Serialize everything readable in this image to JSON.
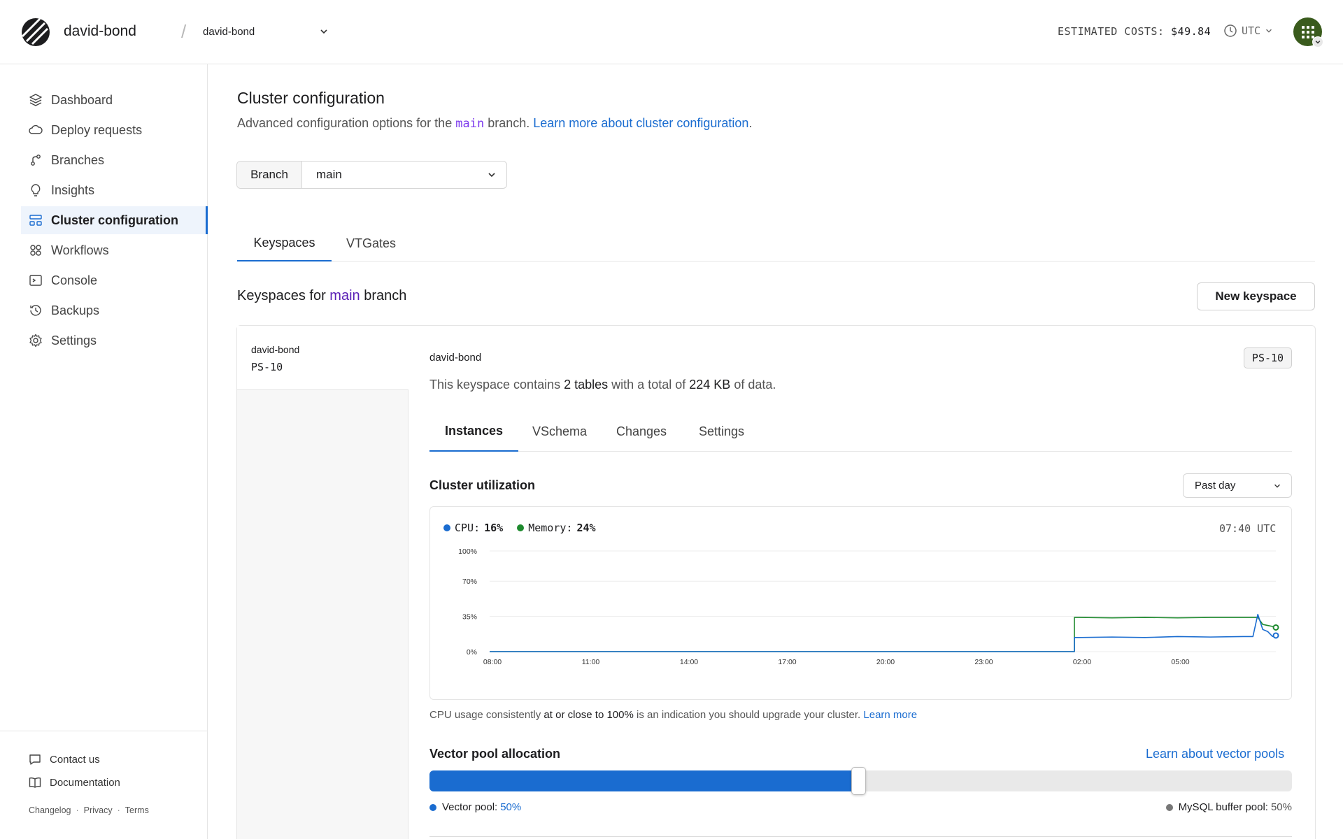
{
  "header": {
    "org_name": "david-bond",
    "database_select": "david-bond",
    "estimated_costs_label": "ESTIMATED COSTS:",
    "estimated_costs_value": "$49.84",
    "timezone": "UTC"
  },
  "sidebar": {
    "items": [
      {
        "label": "Dashboard",
        "icon": "layers-icon"
      },
      {
        "label": "Deploy requests",
        "icon": "cloud-icon"
      },
      {
        "label": "Branches",
        "icon": "branch-icon"
      },
      {
        "label": "Insights",
        "icon": "lightbulb-icon"
      },
      {
        "label": "Cluster configuration",
        "icon": "cluster-icon",
        "active": true
      },
      {
        "label": "Workflows",
        "icon": "workflows-icon"
      },
      {
        "label": "Console",
        "icon": "terminal-icon"
      },
      {
        "label": "Backups",
        "icon": "backup-icon"
      },
      {
        "label": "Settings",
        "icon": "gear-icon"
      }
    ],
    "footer": {
      "contact": "Contact us",
      "documentation": "Documentation",
      "changelog": "Changelog",
      "privacy": "Privacy",
      "terms": "Terms",
      "separator": "·"
    }
  },
  "main": {
    "title": "Cluster configuration",
    "subtitle_prefix": "Advanced configuration options for the",
    "subtitle_branch": "main",
    "subtitle_mid": "branch.",
    "subtitle_link": "Learn more about cluster configuration",
    "subtitle_end": ".",
    "branch_label": "Branch",
    "branch_value": "main",
    "tabs": [
      {
        "label": "Keyspaces",
        "active": true
      },
      {
        "label": "VTGates",
        "active": false
      }
    ],
    "keyspaces_title_prefix": "Keyspaces for",
    "keyspaces_title_branch": "main",
    "keyspaces_title_suffix": "branch",
    "new_keyspace_button": "New keyspace"
  },
  "keyspace": {
    "list_item_name": "david-bond",
    "list_item_plan": "PS-10",
    "name": "david-bond",
    "plan_badge": "PS-10",
    "desc_prefix": "This keyspace contains",
    "desc_tables": "2 tables",
    "desc_mid": "with a total of",
    "desc_size": "224 KB",
    "desc_suffix": "of data.",
    "tabs": [
      {
        "label": "Instances",
        "active": true
      },
      {
        "label": "VSchema",
        "active": false
      },
      {
        "label": "Changes",
        "active": false
      },
      {
        "label": "Settings",
        "active": false
      }
    ],
    "utilization_title": "Cluster utilization",
    "range_select": "Past day",
    "legend_cpu_label": "CPU:",
    "legend_cpu_value": "16%",
    "legend_mem_label": "Memory:",
    "legend_mem_value": "24%",
    "time_readout": "07:40 UTC",
    "note_prefix": "CPU usage consistently",
    "note_emph": "at or close to 100%",
    "note_mid": "is an indication you should upgrade your cluster.",
    "note_link": "Learn more",
    "vector_title": "Vector pool allocation",
    "vector_link": "Learn about vector pools",
    "vector_pool_label": "Vector pool:",
    "vector_pool_value": "50%",
    "buffer_pool_label": "MySQL buffer pool:",
    "buffer_pool_value": "50%",
    "vector_pool_fraction": 0.5
  },
  "colors": {
    "accent": "#1a6cd0",
    "cpu": "#1a6cd0",
    "memory": "#1e8a2e",
    "branch_purple": "#7c3aed",
    "buffer_dot": "#777777"
  },
  "chart_data": {
    "type": "line",
    "xlabels": [
      "08:00",
      "11:00",
      "14:00",
      "17:00",
      "20:00",
      "23:00",
      "02:00",
      "05:00"
    ],
    "ylabels": [
      "100%",
      "70%",
      "35%",
      "0%"
    ],
    "ylim": [
      0,
      100
    ],
    "grid": true,
    "series": [
      {
        "name": "CPU",
        "x": [
          0,
          17.7,
          17.85,
          18,
          19,
          20,
          21,
          22,
          23,
          23.3,
          23.45,
          23.6,
          23.75,
          23.9,
          24
        ],
        "values": [
          0,
          0,
          14,
          14,
          14.5,
          14,
          15,
          14.5,
          15,
          15,
          37,
          22,
          20,
          15,
          16
        ]
      },
      {
        "name": "Memory",
        "x": [
          0,
          17.7,
          17.85,
          18,
          19,
          20,
          21,
          22,
          23,
          23.3,
          23.45,
          23.6,
          23.75,
          23.9,
          24
        ],
        "values": [
          0,
          0,
          34,
          34,
          33.5,
          34,
          33.5,
          34,
          34,
          34,
          34,
          27,
          26,
          25,
          24
        ]
      }
    ]
  }
}
